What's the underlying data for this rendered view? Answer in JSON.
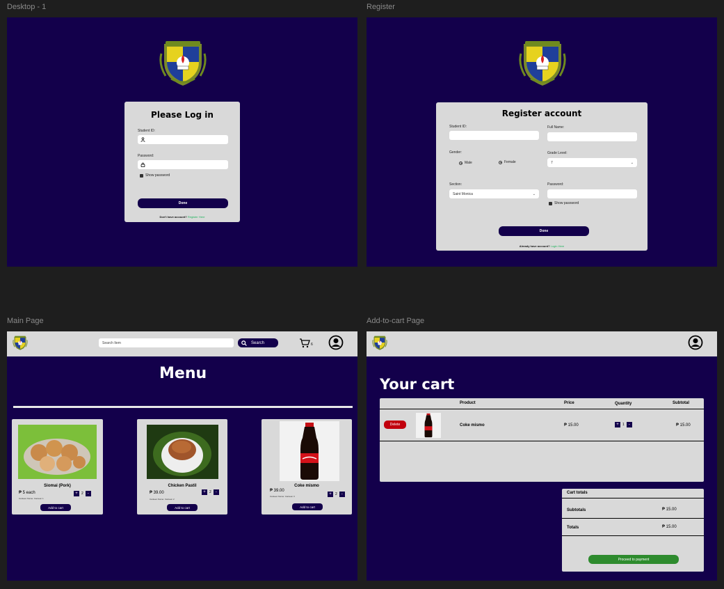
{
  "frames": {
    "login_label": "Desktop - 1",
    "register_label": "Register",
    "main_label": "Main Page",
    "cart_label": "Add-to-cart Page"
  },
  "login": {
    "title": "Please Log in",
    "student_id_label": "Student ID:",
    "password_label": "Password:",
    "show_password": "Show password",
    "done": "Done",
    "footer_text": "Don't have account?",
    "footer_link": "Register Here"
  },
  "register": {
    "title": "Register account",
    "student_id_label": "Student ID:",
    "full_name_label": "Full Name:",
    "gender_label": "Gender:",
    "male": "Male",
    "female": "Female",
    "grade_label": "Grade Level:",
    "grade_value": "7",
    "section_label": "Section:",
    "section_value": "Saint Monica",
    "password_label": "Password:",
    "show_password": "Show password",
    "done": "Done",
    "footer_text": "Already have account?",
    "footer_link": "Login Here"
  },
  "main": {
    "search_placeholder": "Search Item",
    "search_button": "Search",
    "cart_count": "6",
    "title": "Menu",
    "products": [
      {
        "name": "Siomai (Pork)",
        "price": "₱ 5 each",
        "canteen": "Canteen Name: Canteen 1",
        "qty": "2",
        "add": "Add to cart"
      },
      {
        "name": "Chicken Pastil",
        "price": "₱ 39.00",
        "canteen": "Canteen Name: Canteen 2",
        "qty": "2",
        "add": "Add to cart"
      },
      {
        "name": "Coke mismo",
        "price": "₱ 39.00",
        "canteen": "Canteen Name: Canteen 3",
        "qty": "2",
        "add": "Add to cart"
      }
    ],
    "plus": "+",
    "minus": "-"
  },
  "cart": {
    "title": "Your cart",
    "headers": {
      "product": "Product",
      "price": "Price",
      "quantity": "Quantity",
      "subtotal": "Subtotal"
    },
    "row": {
      "delete": "Delete",
      "name": "Coke mismo",
      "price": "₱ 15.00",
      "qty": "1",
      "subtotal": "₱ 15.00"
    },
    "totals_title": "Cart totals",
    "subtotals_label": "Subtotals",
    "subtotals_value": "₱ 15.00",
    "totals_label": "Totals",
    "totals_value": "₱ 15.00",
    "proceed": "Proceed to payment",
    "plus": "+",
    "minus": "-"
  },
  "colors": {
    "navy": "#13004b",
    "panel": "#d9d9d9",
    "canvas": "#1e1e1e",
    "delete": "#c1000d",
    "proceed": "#2e8b2e",
    "link": "#1fb35c"
  },
  "icons": [
    "school-seal-icon",
    "user-icon",
    "lock-icon",
    "search-icon",
    "cart-icon",
    "profile-icon",
    "chevron-down-icon",
    "checkbox-icon"
  ]
}
